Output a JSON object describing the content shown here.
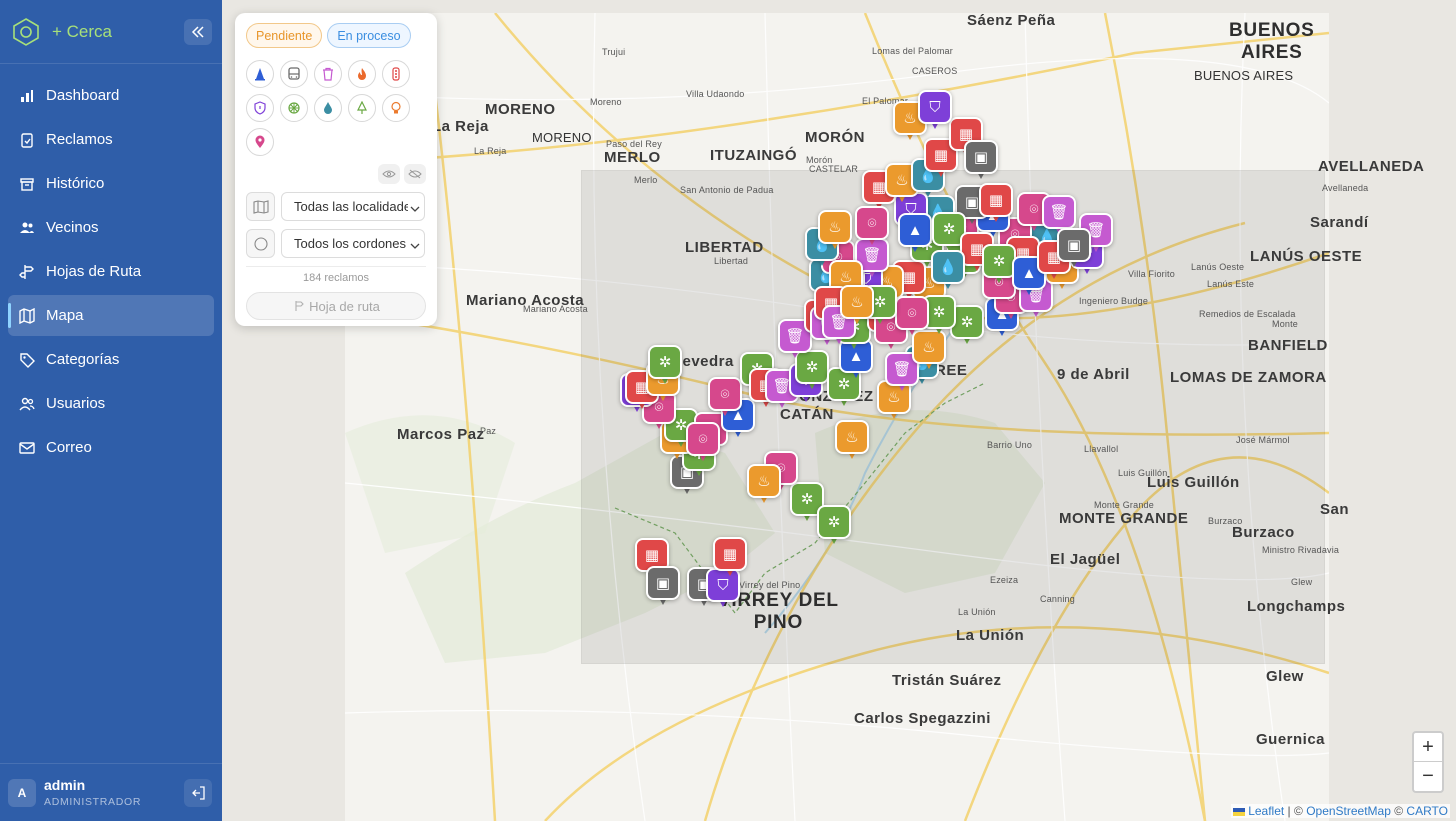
{
  "app": {
    "name": "+ Cerca"
  },
  "sidebar": {
    "items": [
      {
        "label": "Dashboard",
        "icon": "bar-chart-icon"
      },
      {
        "label": "Reclamos",
        "icon": "clipboard-icon"
      },
      {
        "label": "Histórico",
        "icon": "archive-icon"
      },
      {
        "label": "Vecinos",
        "icon": "users-icon"
      },
      {
        "label": "Hojas de Ruta",
        "icon": "route-icon"
      },
      {
        "label": "Mapa",
        "icon": "map-icon",
        "active": true
      },
      {
        "label": "Categorías",
        "icon": "tag-icon"
      },
      {
        "label": "Usuarios",
        "icon": "user-group-icon"
      },
      {
        "label": "Correo",
        "icon": "mail-icon"
      }
    ],
    "user": {
      "initial": "A",
      "name": "admin",
      "role": "ADMINISTRADOR"
    }
  },
  "filters": {
    "status_chips": [
      "Pendiente",
      "En proceso"
    ],
    "categories": [
      "cone-icon",
      "bus-icon",
      "trash-icon",
      "fire-icon",
      "traffic-light-icon",
      "shield-icon",
      "tree-wheel-icon",
      "water-drop-icon",
      "tree-icon",
      "lightbulb-icon",
      "map-pin-icon"
    ],
    "locality_select": "Todas las localidades",
    "cordon_select": "Todos los cordones",
    "count_text": "184 reclamos",
    "route_button": "Hoja de ruta"
  },
  "map": {
    "places": [
      "Sáenz Peña",
      "BUENOS AIRES",
      "BUENOS AIRES",
      "MORENO",
      "MORENO",
      "Moreno",
      "La Reja",
      "La Reja",
      "Paso del Rey",
      "MERLO",
      "Merlo",
      "ITUZAINGÓ",
      "MORÓN",
      "Morón",
      "CASTELAR",
      "Villa Udaondo",
      "CASEROS",
      "El Palomar",
      "Lomas del Palomar",
      "Trujui",
      "San Antonio de Padua",
      "LIBERTAD",
      "Libertad",
      "Mariano Acosta",
      "Mariano Acosta",
      "Marcos Paz",
      "Paz",
      "tevedra",
      "CATÁN",
      "GONZÁLEZ",
      "REE",
      "9 de Abril",
      "LANÚS OESTE",
      "Lanús Oeste",
      "Lanús Este",
      "BANFIELD",
      "LOMAS DE ZAMORA",
      "AVELLANEDA",
      "Avellaneda",
      "Remedios de Escalada",
      "Monte",
      "Villa Fiorito",
      "Ingeniero Budge",
      "Luis Guillón",
      "Luis Guillón",
      "MONTE GRANDE",
      "Monte Grande",
      "El Jagüel",
      "Burzaco",
      "Burzaco",
      "Longchamps",
      "José Mármol",
      "La Unión",
      "La Unión",
      "Tristán Suárez",
      "Carlos Spegazzini",
      "Glew",
      "Guernica",
      "VIRREY DEL PINO",
      "Virrey del Pino",
      "Ezeiza",
      "Canning",
      "Barrio Uno",
      "San",
      "Sarandí",
      "Llavallol",
      "Ministro Rivadavia",
      "Glew"
    ],
    "zoom_in": "+",
    "zoom_out": "−",
    "attribution": {
      "leaflet": "Leaflet",
      "separator": " | © ",
      "osm": "OpenStreetMap",
      "carto_sep": " © ",
      "carto": "CARTO"
    }
  },
  "colors": {
    "sidebar": "#2f5ea9",
    "pending": "#e8962b",
    "in_process": "#3b8ee0",
    "red": "#e04848",
    "orange": "#eb9a2d",
    "green": "#6aa843",
    "purple": "#7e3fd8",
    "pink": "#d6488c",
    "gray": "#6b6b6b",
    "blue": "#2e5ed6",
    "magenta": "#c55ad0",
    "teal": "#3b8ea3"
  }
}
